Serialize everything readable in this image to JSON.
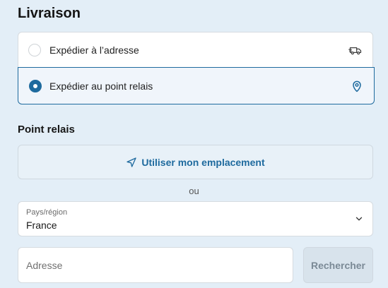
{
  "delivery": {
    "title": "Livraison",
    "options": [
      {
        "label": "Expédier à l’adresse",
        "icon": "delivery-truck-icon",
        "selected": false
      },
      {
        "label": "Expédier au point relais",
        "icon": "map-pin-icon",
        "selected": true
      }
    ]
  },
  "pickup": {
    "title": "Point relais",
    "use_location_label": "Utiliser mon emplacement",
    "use_location_icon": "navigation-arrow-icon",
    "or_label": "ou",
    "country": {
      "label": "Pays/région",
      "value": "France"
    },
    "address": {
      "placeholder": "Adresse"
    },
    "search_label": "Rechercher"
  },
  "colors": {
    "accent": "#1e6a9e",
    "background": "#e3eef7",
    "selected_option_bg": "#f0f5fb",
    "disabled_button_bg": "#d8e3ec"
  }
}
